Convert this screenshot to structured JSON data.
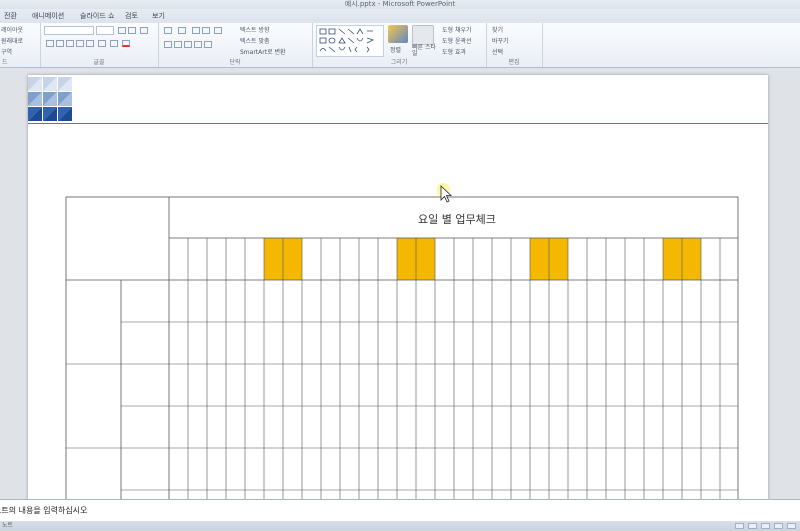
{
  "window": {
    "title": "예시.pptx - Microsoft PowerPoint"
  },
  "ribbon_tabs": [
    "전환",
    "애니메이션",
    "슬라이드 쇼",
    "검토",
    "보기"
  ],
  "ribbon": {
    "slides_group": {
      "layout": "레이아웃",
      "reset": "원래대로",
      "section": "구역",
      "label": "드"
    },
    "font_group": {
      "label": "글꼴"
    },
    "paragraph_group": {
      "label": "단락",
      "text_direction": "텍스트 방향",
      "align_text": "텍스트 맞춤",
      "smartart": "SmartArt로 변환"
    },
    "drawing_group": {
      "label": "그리기",
      "arrange": "정렬",
      "quick_styles": "빠른 스타일",
      "shape_fill": "도형 채우기",
      "shape_outline": "도형 윤곽선",
      "shape_effects": "도형 효과"
    },
    "editing_group": {
      "label": "편집",
      "find": "찾기",
      "replace": "바꾸기",
      "select": "선택"
    }
  },
  "slide": {
    "table_title": "요일 별 업무체크",
    "highlight_color": "#f5b800",
    "accent_line_color": "#4f7ab3"
  },
  "notes": {
    "placeholder": "노트의 내용을 입력하십시오"
  },
  "statusbar": {
    "left": "노트"
  }
}
